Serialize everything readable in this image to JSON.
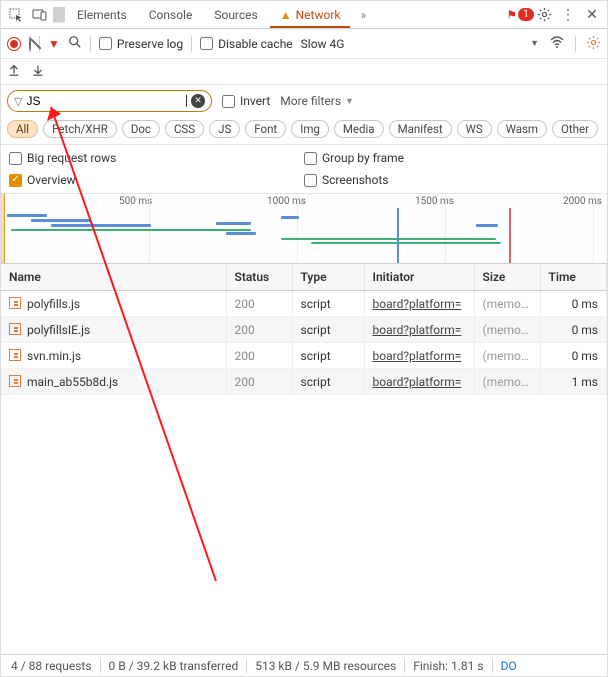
{
  "tabs": {
    "elements": "Elements",
    "console": "Console",
    "sources": "Sources",
    "network": "Network",
    "issue_count": "1"
  },
  "toolbar": {
    "preserve": "Preserve log",
    "disable_cache": "Disable cache",
    "throttle": "Slow 4G"
  },
  "filter": {
    "value": "JS",
    "invert": "Invert",
    "more": "More filters"
  },
  "types": [
    "All",
    "Fetch/XHR",
    "Doc",
    "CSS",
    "JS",
    "Font",
    "Img",
    "Media",
    "Manifest",
    "WS",
    "Wasm",
    "Other"
  ],
  "options": {
    "big_rows": "Big request rows",
    "overview": "Overview",
    "group_frame": "Group by frame",
    "screenshots": "Screenshots"
  },
  "timeline": {
    "ticks": [
      "500 ms",
      "1000 ms",
      "1500 ms",
      "2000 ms"
    ]
  },
  "table": {
    "headers": {
      "name": "Name",
      "status": "Status",
      "type": "Type",
      "initiator": "Initiator",
      "size": "Size",
      "time": "Time"
    },
    "rows": [
      {
        "name": "polyfills.js",
        "status": "200",
        "type": "script",
        "initiator": "board?platform=",
        "size": "(memo…",
        "time": "0 ms"
      },
      {
        "name": "polyfillsIE.js",
        "status": "200",
        "type": "script",
        "initiator": "board?platform=",
        "size": "(memo…",
        "time": "0 ms"
      },
      {
        "name": "svn.min.js",
        "status": "200",
        "type": "script",
        "initiator": "board?platform=",
        "size": "(memo…",
        "time": "0 ms"
      },
      {
        "name": "main_ab55b8d.js",
        "status": "200",
        "type": "script",
        "initiator": "board?platform=",
        "size": "(memo…",
        "time": "1 ms"
      }
    ]
  },
  "status": {
    "requests": "4 / 88 requests",
    "transferred": "0 B / 39.2 kB transferred",
    "resources": "513 kB / 5.9 MB resources",
    "finish": "Finish: 1.81 s",
    "dom": "DO"
  }
}
